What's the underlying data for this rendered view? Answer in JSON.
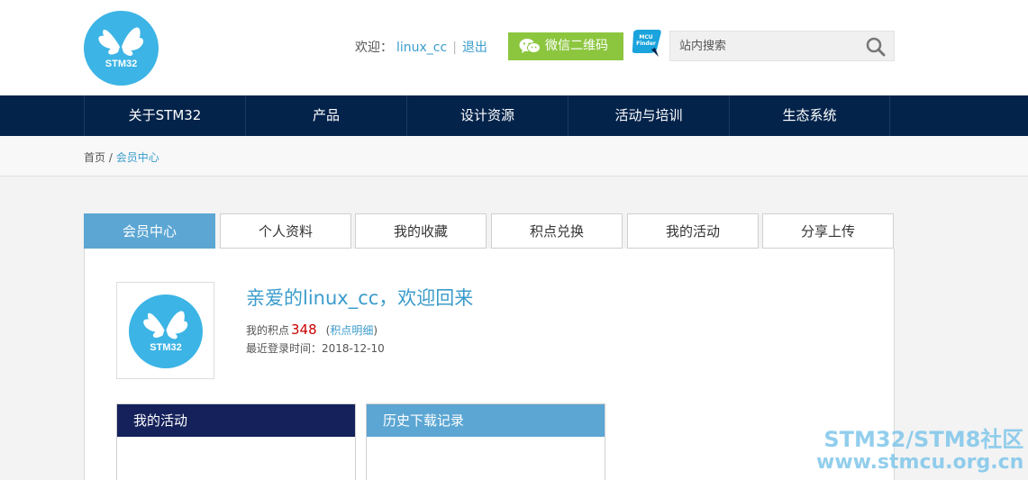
{
  "header": {
    "logo_text": "STM32",
    "welcome_label": "欢迎：",
    "username": "linux_cc",
    "separator": "|",
    "logout_label": "退出",
    "wechat_label": "微信二维码",
    "mcu_finder_label": "MCU Finder",
    "search_placeholder": "站内搜索"
  },
  "nav": {
    "items": [
      {
        "label": "关于STM32"
      },
      {
        "label": "产品"
      },
      {
        "label": "设计资源"
      },
      {
        "label": "活动与培训"
      },
      {
        "label": "生态系统"
      }
    ]
  },
  "breadcrumb": {
    "home": "首页",
    "separator": " / ",
    "current": "会员中心"
  },
  "tabs": [
    {
      "label": "会员中心",
      "active": true
    },
    {
      "label": "个人资料"
    },
    {
      "label": "我的收藏"
    },
    {
      "label": "积点兑换"
    },
    {
      "label": "我的活动"
    },
    {
      "label": "分享上传"
    }
  ],
  "profile": {
    "avatar_text": "STM32",
    "greeting": "亲爱的linux_cc，欢迎回来",
    "points_label": "我的积点",
    "points_value": "348",
    "points_detail_open": "(",
    "points_detail_link": "积点明细",
    "points_detail_close": ")",
    "last_login": "最近登录时间：2018-12-10"
  },
  "boxes": {
    "activity_title": "我的活动",
    "download_title": "历史下载记录"
  },
  "watermark": {
    "line1": "STM32/STM8社区",
    "line2": "www.stmcu.org.cn"
  },
  "colors": {
    "nav_bg": "#03234b",
    "accent": "#3b9ccc",
    "tab_active": "#5ba6d3",
    "wechat_green": "#8cc63f",
    "points_red": "#cc0000"
  }
}
